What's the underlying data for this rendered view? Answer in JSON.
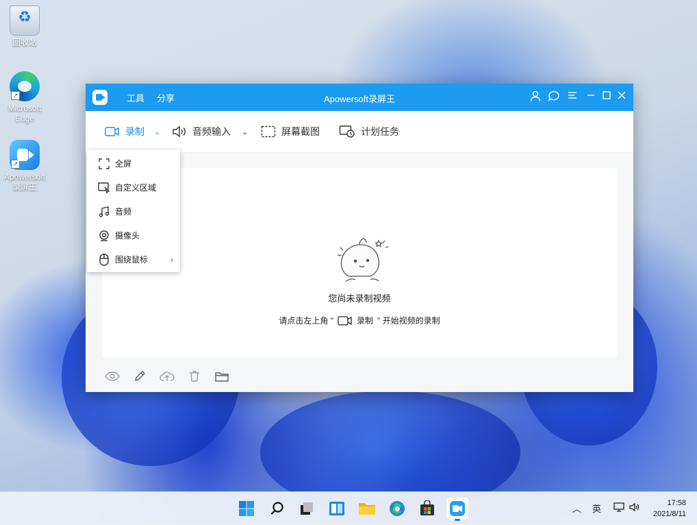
{
  "desktop": {
    "icons": [
      {
        "label": "回收站",
        "icon": "recycle-bin-icon"
      },
      {
        "label": "Microsoft Edge",
        "icon": "edge-icon"
      },
      {
        "label": "Apowersoft 录屏王",
        "icon": "apowersoft-icon"
      }
    ]
  },
  "window": {
    "title": "Apowersoft录屏王",
    "menu": [
      "工具",
      "分享"
    ],
    "toolbar": {
      "record": "录制",
      "audio_input": "音频输入",
      "screenshot": "屏幕截图",
      "schedule": "计划任务"
    },
    "empty_state": {
      "title": "您尚未录制视频",
      "hint_prefix": "请点击左上角 \"",
      "hint_record": "录制",
      "hint_suffix": "\" 开始视频的录制"
    }
  },
  "record_menu": {
    "items": [
      {
        "label": "全屏",
        "icon": "fullscreen-icon"
      },
      {
        "label": "自定义区域",
        "icon": "custom-region-icon"
      },
      {
        "label": "音频",
        "icon": "music-note-icon"
      },
      {
        "label": "摄像头",
        "icon": "webcam-icon"
      },
      {
        "label": "围绕鼠标",
        "icon": "mouse-icon",
        "has_submenu": true
      }
    ]
  },
  "taskbar": {
    "tray": {
      "ime": "英"
    },
    "clock": {
      "time": "17:58",
      "date": "2021/8/11"
    }
  },
  "colors": {
    "accent": "#1c9bf0",
    "active_tool": "#1c8ee8"
  }
}
